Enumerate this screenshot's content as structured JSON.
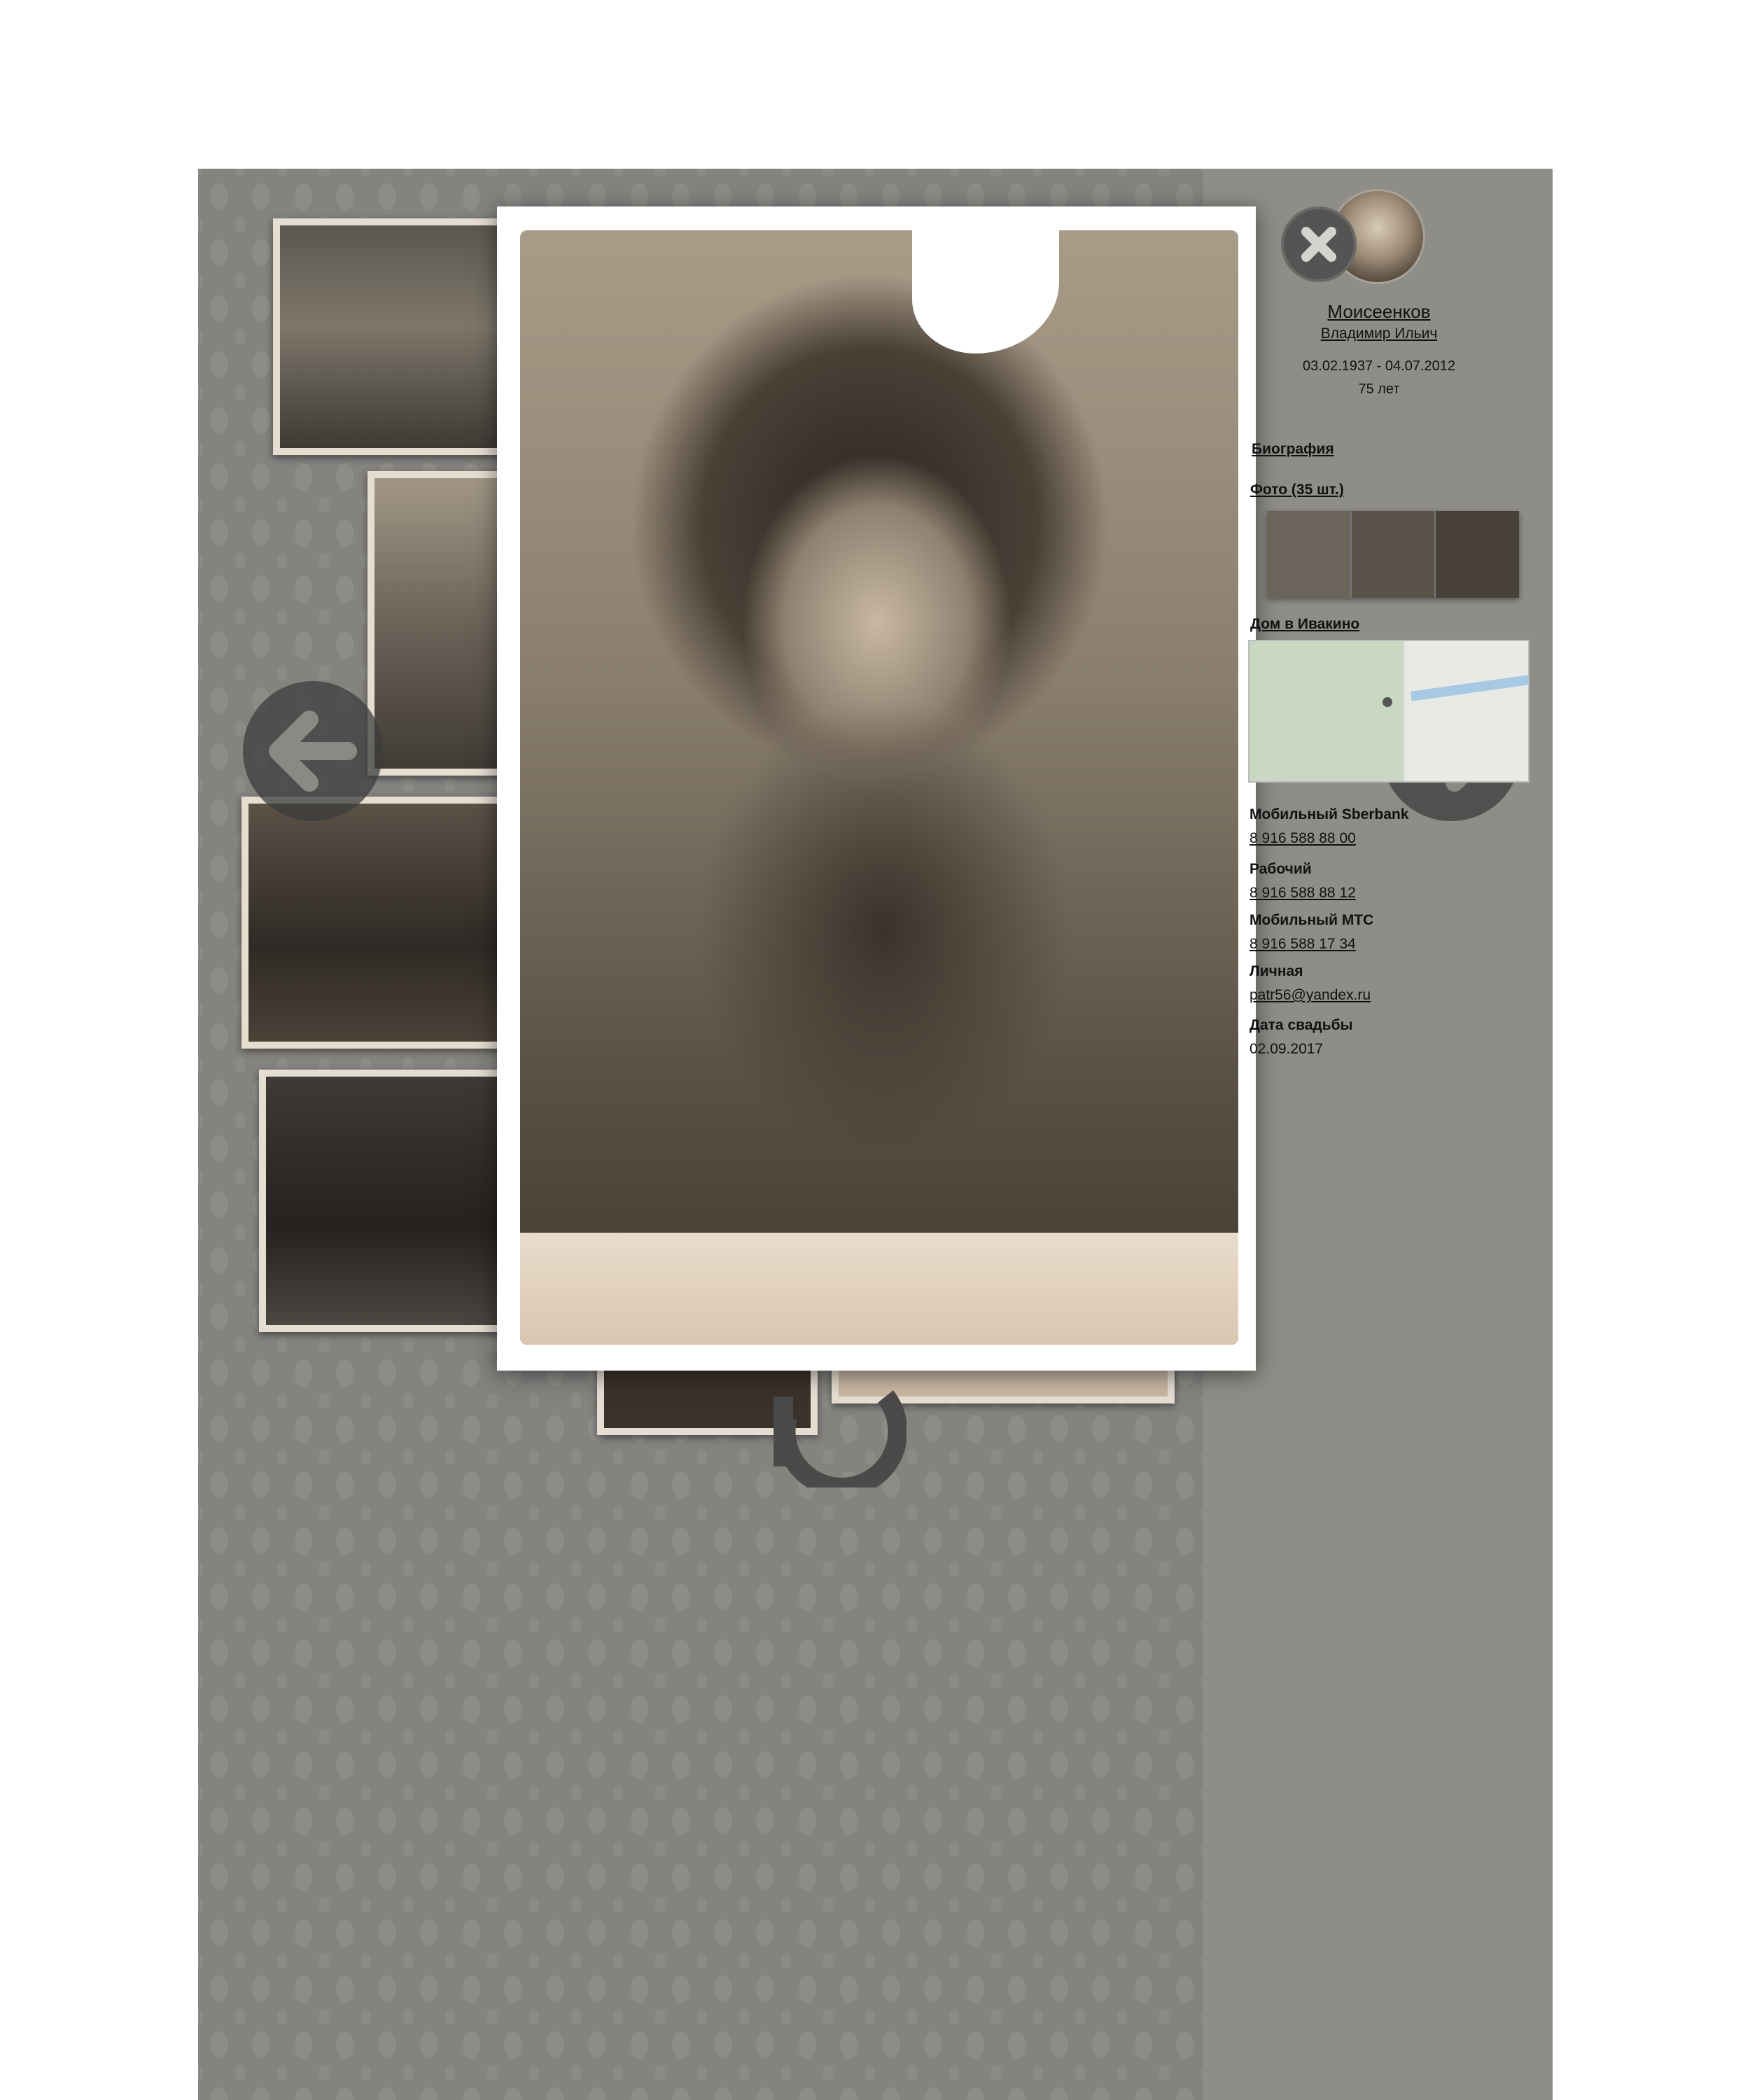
{
  "person": {
    "last_name": "Моисеенков",
    "first_name": "Владимир Ильич",
    "dates": "03.02.1937 - 04.07.2012",
    "age": "75 лет"
  },
  "sections": {
    "biography": "Биография",
    "photos": "Фото (35 шт.)",
    "house": "Дом в Ивакино"
  },
  "contacts": [
    {
      "label": "Мобильный Sberbank",
      "value": "8 916 588 88 00"
    },
    {
      "label": "Рабочий",
      "value": "8 916 588 88 12"
    },
    {
      "label": "Мобильный МТС",
      "value": "8 916 588 17 34"
    },
    {
      "label": "Личная",
      "value": "patr56@yandex.ru"
    },
    {
      "label": "Дата свадьбы",
      "value": "02.09.2017"
    }
  ],
  "icons": {
    "prev": "arrow-left-icon",
    "next": "arrow-right-icon",
    "close": "close-icon",
    "rotate": "rotate-icon"
  }
}
